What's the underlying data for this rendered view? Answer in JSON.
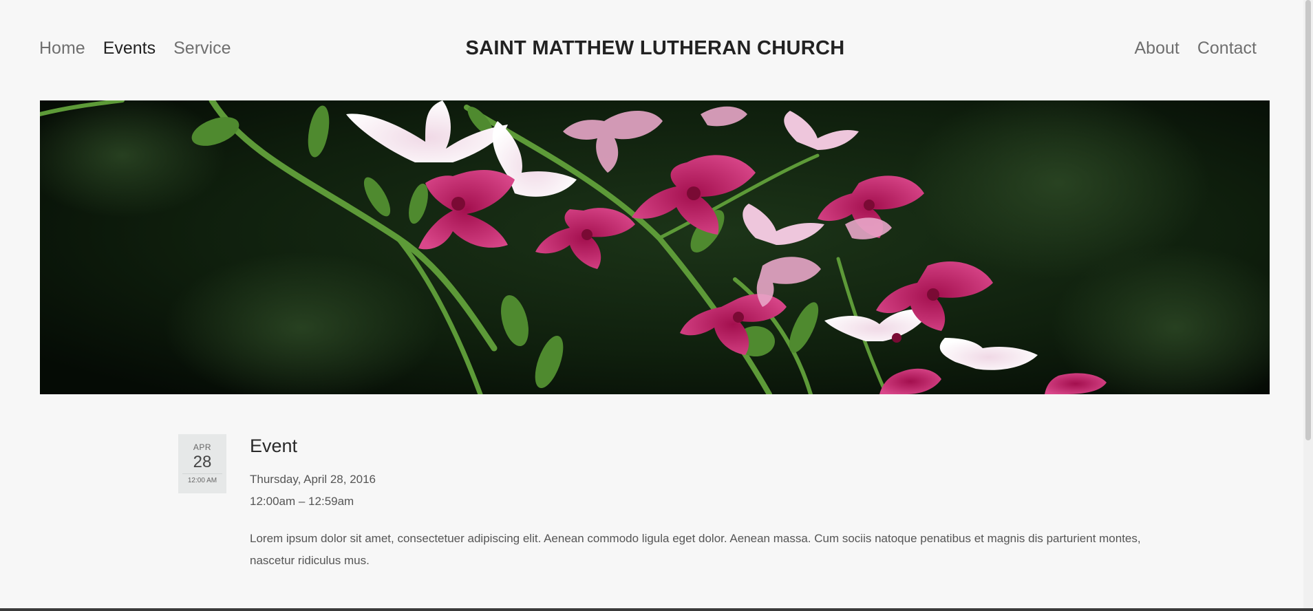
{
  "header": {
    "site_title": "SAINT MATTHEW LUTHERAN CHURCH",
    "nav_left": [
      {
        "label": "Home",
        "active": false
      },
      {
        "label": "Events",
        "active": true
      },
      {
        "label": "Service",
        "active": false
      }
    ],
    "nav_right": [
      {
        "label": "About",
        "active": false
      },
      {
        "label": "Contact",
        "active": false
      }
    ]
  },
  "hero": {
    "subject": "orchid-flowers-photo"
  },
  "event": {
    "month": "APR",
    "day": "28",
    "time_badge": "12:00 AM",
    "title": "Event",
    "date_line": "Thursday, April 28, 2016",
    "time_line": "12:00am – 12:59am",
    "description": "Lorem ipsum dolor sit amet, consectetuer adipiscing elit. Aenean commodo ligula eget dolor. Aenean massa. Cum sociis natoque penatibus et magnis dis parturient montes, nascetur ridiculus mus."
  },
  "colors": {
    "background": "#f7f7f7",
    "text_dark": "#222222",
    "text_muted": "#6f6f6f",
    "date_box": "#e6e8e8",
    "flower_magenta": "#c2185b",
    "flower_pink": "#e8a6c8",
    "leaf_green": "#4f8a2f"
  }
}
